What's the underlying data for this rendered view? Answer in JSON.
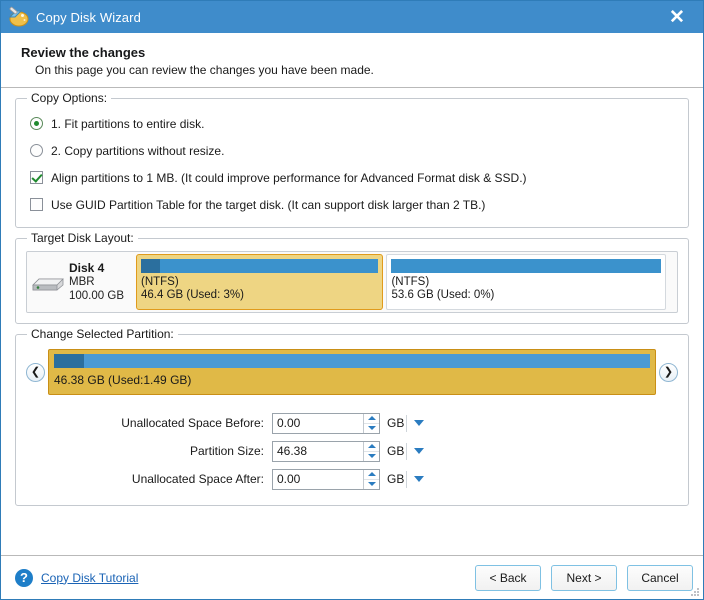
{
  "window": {
    "title": "Copy Disk Wizard",
    "icon": "copy-disk-wizard-icon",
    "close_label": "✕",
    "accent_color": "#3f8ccb"
  },
  "header": {
    "title": "Review the changes",
    "subtitle": "On this page you can review the changes you have been made."
  },
  "copy_options": {
    "legend": "Copy Options:",
    "items": [
      {
        "type": "radio",
        "checked": true,
        "label": "1. Fit partitions to entire disk."
      },
      {
        "type": "radio",
        "checked": false,
        "label": "2. Copy partitions without resize."
      },
      {
        "type": "checkbox",
        "checked": true,
        "label": "Align partitions to 1 MB.  (It could improve performance for Advanced Format disk & SSD.)"
      },
      {
        "type": "checkbox",
        "checked": false,
        "label": "Use GUID Partition Table for the target disk. (It can support disk larger than 2 TB.)"
      }
    ]
  },
  "target_disk_layout": {
    "legend": "Target Disk Layout:",
    "disk": {
      "name": "Disk 4",
      "scheme": "MBR",
      "capacity": "100.00 GB"
    },
    "partitions": [
      {
        "selected": true,
        "filesystem": "(NTFS)",
        "summary": "46.4 GB (Used: 3%)",
        "used_percent": 3,
        "width_percent": 46
      },
      {
        "selected": false,
        "filesystem": "(NTFS)",
        "summary": "53.6 GB (Used: 0%)",
        "used_percent": 0,
        "width_percent": 54
      }
    ]
  },
  "change_selected_partition": {
    "legend": "Change Selected Partition:",
    "left_handle": "❮",
    "right_handle": "❯",
    "partition_caption": "46.38 GB (Used:1.49 GB)",
    "used_percent": 3,
    "fields": [
      {
        "label": "Unallocated Space Before:",
        "value": "0.00",
        "unit": "GB"
      },
      {
        "label": "Partition Size:",
        "value": "46.38",
        "unit": "GB"
      },
      {
        "label": "Unallocated Space After:",
        "value": "0.00",
        "unit": "GB"
      }
    ]
  },
  "footer": {
    "help_glyph": "?",
    "tutorial_link": "Copy Disk Tutorial",
    "buttons": [
      {
        "label": "< Back"
      },
      {
        "label": "Next >"
      },
      {
        "label": "Cancel"
      }
    ]
  }
}
